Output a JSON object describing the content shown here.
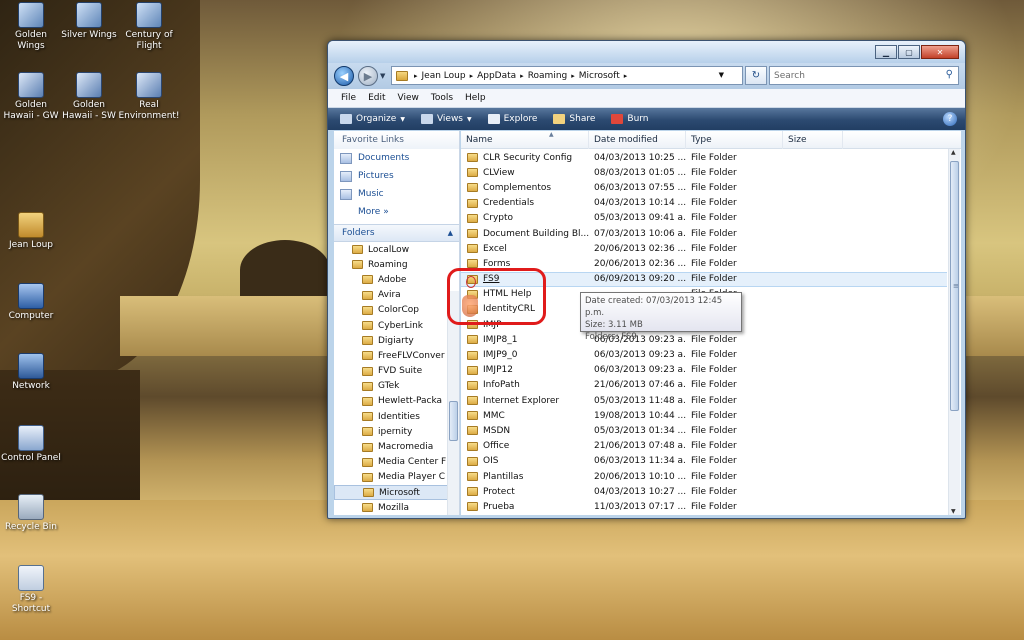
{
  "desktop": {
    "icons": [
      {
        "label": "Golden Wings",
        "icon": "airplane-icon"
      },
      {
        "label": "Silver Wings",
        "icon": "airplane-icon"
      },
      {
        "label": "Century of Flight",
        "icon": "airplane-icon"
      },
      {
        "label": "Golden Hawaii - GW",
        "icon": "building-icon"
      },
      {
        "label": "Golden Hawaii - SW",
        "icon": "building-icon"
      },
      {
        "label": "Real Environment!",
        "icon": "building-icon"
      },
      {
        "label": "Jean Loup",
        "icon": "user-folder-icon"
      },
      {
        "label": "Computer",
        "icon": "computer-icon"
      },
      {
        "label": "Network",
        "icon": "network-icon"
      },
      {
        "label": "Control Panel",
        "icon": "control-panel-icon"
      },
      {
        "label": "Recycle Bin",
        "icon": "recycle-bin-icon"
      },
      {
        "label": "FS9 - Shortcut",
        "icon": "shortcut-icon"
      }
    ]
  },
  "window": {
    "controls": {
      "minimize": "▁",
      "maximize": "▢",
      "close": "✕"
    },
    "nav": {
      "back": "◀",
      "forward": "▶",
      "history": "▼",
      "refresh": "↻",
      "search_icon": "⚲"
    },
    "breadcrumb": [
      "Jean Loup",
      "AppData",
      "Roaming",
      "Microsoft"
    ],
    "breadcrumb_sep": "▸",
    "search_placeholder": "Search",
    "menu": [
      "File",
      "Edit",
      "View",
      "Tools",
      "Help"
    ],
    "toolbar": [
      {
        "label": "Organize",
        "has_arrow": true,
        "color": "#c9d8ec"
      },
      {
        "label": "Views",
        "has_arrow": true,
        "color": "#c9d8ec"
      },
      {
        "label": "Explore",
        "has_arrow": false,
        "color": "#e8eef7"
      },
      {
        "label": "Share",
        "has_arrow": false,
        "color": "#f2d27e"
      },
      {
        "label": "Burn",
        "has_arrow": false,
        "color": "#e0473a"
      }
    ],
    "help": "?",
    "favorites_header": "Favorite Links",
    "favorites": [
      "Documents",
      "Pictures",
      "Music"
    ],
    "more": "More",
    "more_arrow": "»",
    "folders_header": "Folders",
    "folders_arrow": "▲",
    "tree": [
      {
        "label": "LocalLow",
        "indent": 1
      },
      {
        "label": "Roaming",
        "indent": 1
      },
      {
        "label": "Adobe",
        "indent": 2
      },
      {
        "label": "Avira",
        "indent": 2
      },
      {
        "label": "ColorCop",
        "indent": 2
      },
      {
        "label": "CyberLink",
        "indent": 2
      },
      {
        "label": "Digiarty",
        "indent": 2
      },
      {
        "label": "FreeFLVConver",
        "indent": 2
      },
      {
        "label": "FVD Suite",
        "indent": 2
      },
      {
        "label": "GTek",
        "indent": 2
      },
      {
        "label": "Hewlett-Packa",
        "indent": 2
      },
      {
        "label": "Identities",
        "indent": 2
      },
      {
        "label": "ipernity",
        "indent": 2
      },
      {
        "label": "Macromedia",
        "indent": 2
      },
      {
        "label": "Media Center F",
        "indent": 2
      },
      {
        "label": "Media Player C",
        "indent": 2
      },
      {
        "label": "Microsoft",
        "indent": 2,
        "selected": true
      },
      {
        "label": "Mozilla",
        "indent": 2
      }
    ],
    "columns": [
      "Name",
      "Date modified",
      "Type",
      "Size"
    ],
    "sort_arrow": "▲",
    "rows": [
      {
        "name": "CLR Security Config",
        "date": "04/03/2013 10:25 ...",
        "type": "File Folder"
      },
      {
        "name": "CLView",
        "date": "08/03/2013 01:05 ...",
        "type": "File Folder"
      },
      {
        "name": "Complementos",
        "date": "06/03/2013 07:55 ...",
        "type": "File Folder"
      },
      {
        "name": "Credentials",
        "date": "04/03/2013 10:14 ...",
        "type": "File Folder"
      },
      {
        "name": "Crypto",
        "date": "05/03/2013 09:41 a...",
        "type": "File Folder"
      },
      {
        "name": "Document Building Bl...",
        "date": "07/03/2013 10:06 a...",
        "type": "File Folder"
      },
      {
        "name": "Excel",
        "date": "20/06/2013 02:36 ...",
        "type": "File Folder"
      },
      {
        "name": "Forms",
        "date": "20/06/2013 02:36 ...",
        "type": "File Folder"
      },
      {
        "name": "FS9",
        "date": "06/09/2013 09:20 ...",
        "type": "File Folder",
        "highlight": true
      },
      {
        "name": "HTML Help",
        "date": "",
        "type": "File Folder"
      },
      {
        "name": "IdentityCRL",
        "date": "",
        "type": "File Folder"
      },
      {
        "name": "IMJP",
        "date": "",
        "type": "File Folder"
      },
      {
        "name": "IMJP8_1",
        "date": "06/03/2013 09:23 a...",
        "type": "File Folder"
      },
      {
        "name": "IMJP9_0",
        "date": "06/03/2013 09:23 a...",
        "type": "File Folder"
      },
      {
        "name": "IMJP12",
        "date": "06/03/2013 09:23 a...",
        "type": "File Folder"
      },
      {
        "name": "InfoPath",
        "date": "21/06/2013 07:46 a...",
        "type": "File Folder"
      },
      {
        "name": "Internet Explorer",
        "date": "05/03/2013 11:48 a...",
        "type": "File Folder"
      },
      {
        "name": "MMC",
        "date": "19/08/2013 10:44 ...",
        "type": "File Folder"
      },
      {
        "name": "MSDN",
        "date": "05/03/2013 01:34 ...",
        "type": "File Folder"
      },
      {
        "name": "Office",
        "date": "21/06/2013 07:48 a...",
        "type": "File Folder"
      },
      {
        "name": "OIS",
        "date": "06/03/2013 11:34 a...",
        "type": "File Folder"
      },
      {
        "name": "Plantillas",
        "date": "20/06/2013 10:10 ...",
        "type": "File Folder"
      },
      {
        "name": "Protect",
        "date": "04/03/2013 10:27 ...",
        "type": "File Folder"
      },
      {
        "name": "Prueba",
        "date": "11/03/2013 07:17 ...",
        "type": "File Folder"
      }
    ],
    "tooltip": {
      "line1": "Date created: 07/03/2013 12:45 p.m.",
      "line2": "Size: 3.11 MB",
      "line3": "Folders: FS9"
    },
    "scroll_grip": "≡",
    "scroll_up": "▲",
    "scroll_down": "▼"
  },
  "colors": {
    "annotation_ring": "#e01b1b",
    "toolbar": "#2c4a71",
    "link": "#1c4f94"
  }
}
